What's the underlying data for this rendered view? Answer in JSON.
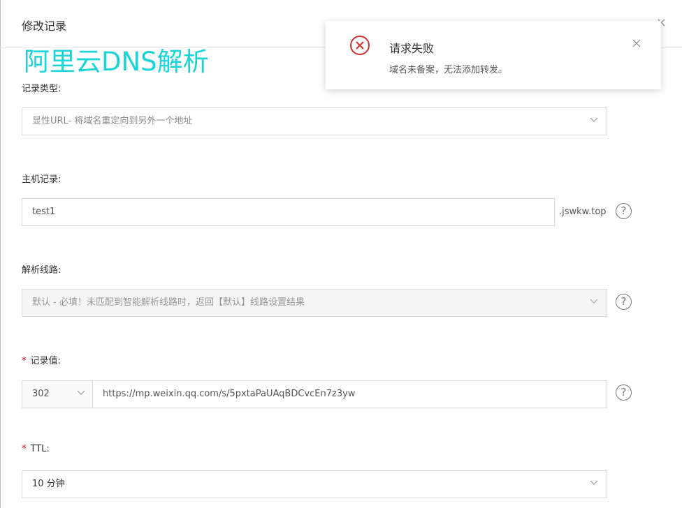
{
  "dialog": {
    "title": "修改记录",
    "close_glyph": "×"
  },
  "watermark": "阿里云DNS解析",
  "record_type": {
    "label": "记录类型:",
    "value": "显性URL- 将域名重定向到另外一个地址"
  },
  "host": {
    "label": "主机记录:",
    "value": "test1",
    "suffix": ".jswkw.top"
  },
  "line": {
    "label": "解析线路:",
    "value": "默认 - 必填！未匹配到智能解析线路时，返回【默认】线路设置结果"
  },
  "record_value": {
    "required_mark": "*",
    "label": "记录值:",
    "code": "302",
    "url": "https://mp.weixin.qq.com/s/5pxtaPaUAqBDCvcEn7z3yw"
  },
  "ttl": {
    "required_mark": "*",
    "label": "TTL:",
    "value": "10 分钟"
  },
  "help_glyph": "?",
  "toast": {
    "title": "请求失败",
    "message": "域名未备案，无法添加转发。",
    "error_color": "#d0312d"
  },
  "icons": {
    "dropdown": "chevron-down-icon",
    "help": "help-circle-icon",
    "error": "error-circle-icon",
    "close": "close-icon"
  }
}
